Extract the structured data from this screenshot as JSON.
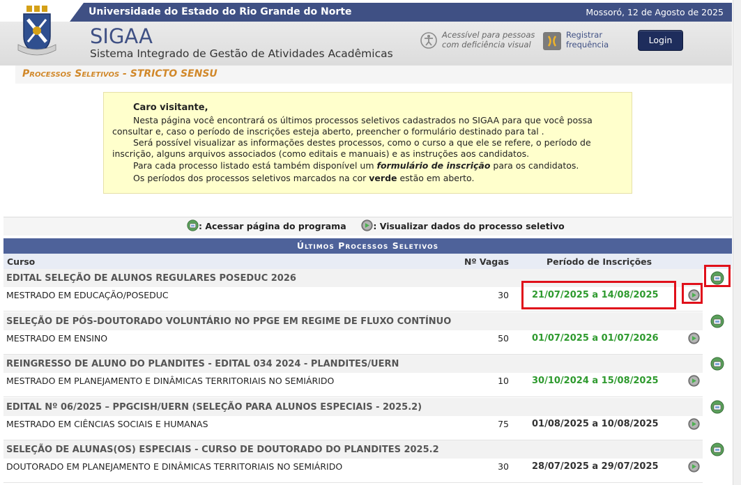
{
  "header": {
    "university": "Universidade do Estado do Rio Grande do Norte",
    "date": "Mossoró, 12 de Agosto de 2025",
    "logo_text": "FIRMA NO SAPIENS",
    "app_name": "SIGAA",
    "app_subtitle": "Sistema Integrado de Gestão de Atividades Acadêmicas",
    "accessibility_line1": "Acessível para pessoas",
    "accessibility_line2": "com deficiência visual",
    "register_line1": "Registrar",
    "register_line2": "frequência",
    "login_label": "Login"
  },
  "breadcrumb": "Processos Seletivos - STRICTO SENSU",
  "info": {
    "greeting": "Caro visitante,",
    "p1": "Nesta página você encontrará os últimos processos seletivos cadastrados no SIGAA para que você possa consultar e, caso o período de inscrições esteja aberto, preencher o formulário destinado para tal .",
    "p2": "Será possível visualizar as informações destes processos, como o curso a que ele se refere, o período de inscrição, alguns arquivos associados (como editais e manuais) e as instruções aos candidatos.",
    "p3_a": "Para cada processo listado está também disponível um ",
    "p3_b": "formulário de inscrição",
    "p3_c": " para os candidatos.",
    "p4_a": "Os períodos dos processos seletivos marcados na cor ",
    "p4_b": "verde",
    "p4_c": " estão em aberto."
  },
  "legend": {
    "program": ": Acessar página do programa",
    "view": ": Visualizar dados do processo seletivo"
  },
  "table": {
    "caption": "Últimos Processos Seletivos",
    "col_course": "Curso",
    "col_vagas": "Nº Vagas",
    "col_period": "Período de Inscrições",
    "rows": [
      {
        "title": "EDITAL SELEÇÃO DE ALUNOS REGULARES POSEDUC 2026",
        "course": "MESTRADO EM EDUCAÇÃO/POSEDUC",
        "vagas": "30",
        "period": "21/07/2025 a 14/08/2025",
        "open": true
      },
      {
        "title": "SELEÇÃO DE PÓS-DOUTORADO VOLUNTÁRIO NO PPGE EM REGIME DE FLUXO CONTÍNUO",
        "course": "MESTRADO EM ENSINO",
        "vagas": "50",
        "period": "01/07/2025 a 01/07/2026",
        "open": true
      },
      {
        "title": "REINGRESSO DE ALUNO DO PLANDITES - EDITAL 034 2024 - PLANDITES/UERN",
        "course": "MESTRADO EM PLANEJAMENTO E DINÂMICAS TERRITORIAIS NO SEMIÁRIDO",
        "vagas": "10",
        "period": "30/10/2024 a 15/08/2025",
        "open": true
      },
      {
        "title": "EDITAL Nº 06/2025 – PPGCISH/UERN (SELEÇÃO PARA ALUNOS ESPECIAIS - 2025.2)",
        "course": "MESTRADO EM CIÊNCIAS SOCIAIS E HUMANAS",
        "vagas": "75",
        "period": "01/08/2025 a 10/08/2025",
        "open": false
      },
      {
        "title": "SELEÇÃO DE ALUNAS(OS) ESPECIAIS - CURSO DE DOUTORADO DO PLANDITES 2025.2",
        "course": "DOUTORADO EM PLANEJAMENTO E DINÂMICAS TERRITORIAIS NO SEMIÁRIDO",
        "vagas": "30",
        "period": "28/07/2025 a 29/07/2025",
        "open": false
      }
    ]
  },
  "colors": {
    "open_period": "#2e9a2e",
    "closed_period": "#333333",
    "highlight": "#e0101a"
  }
}
